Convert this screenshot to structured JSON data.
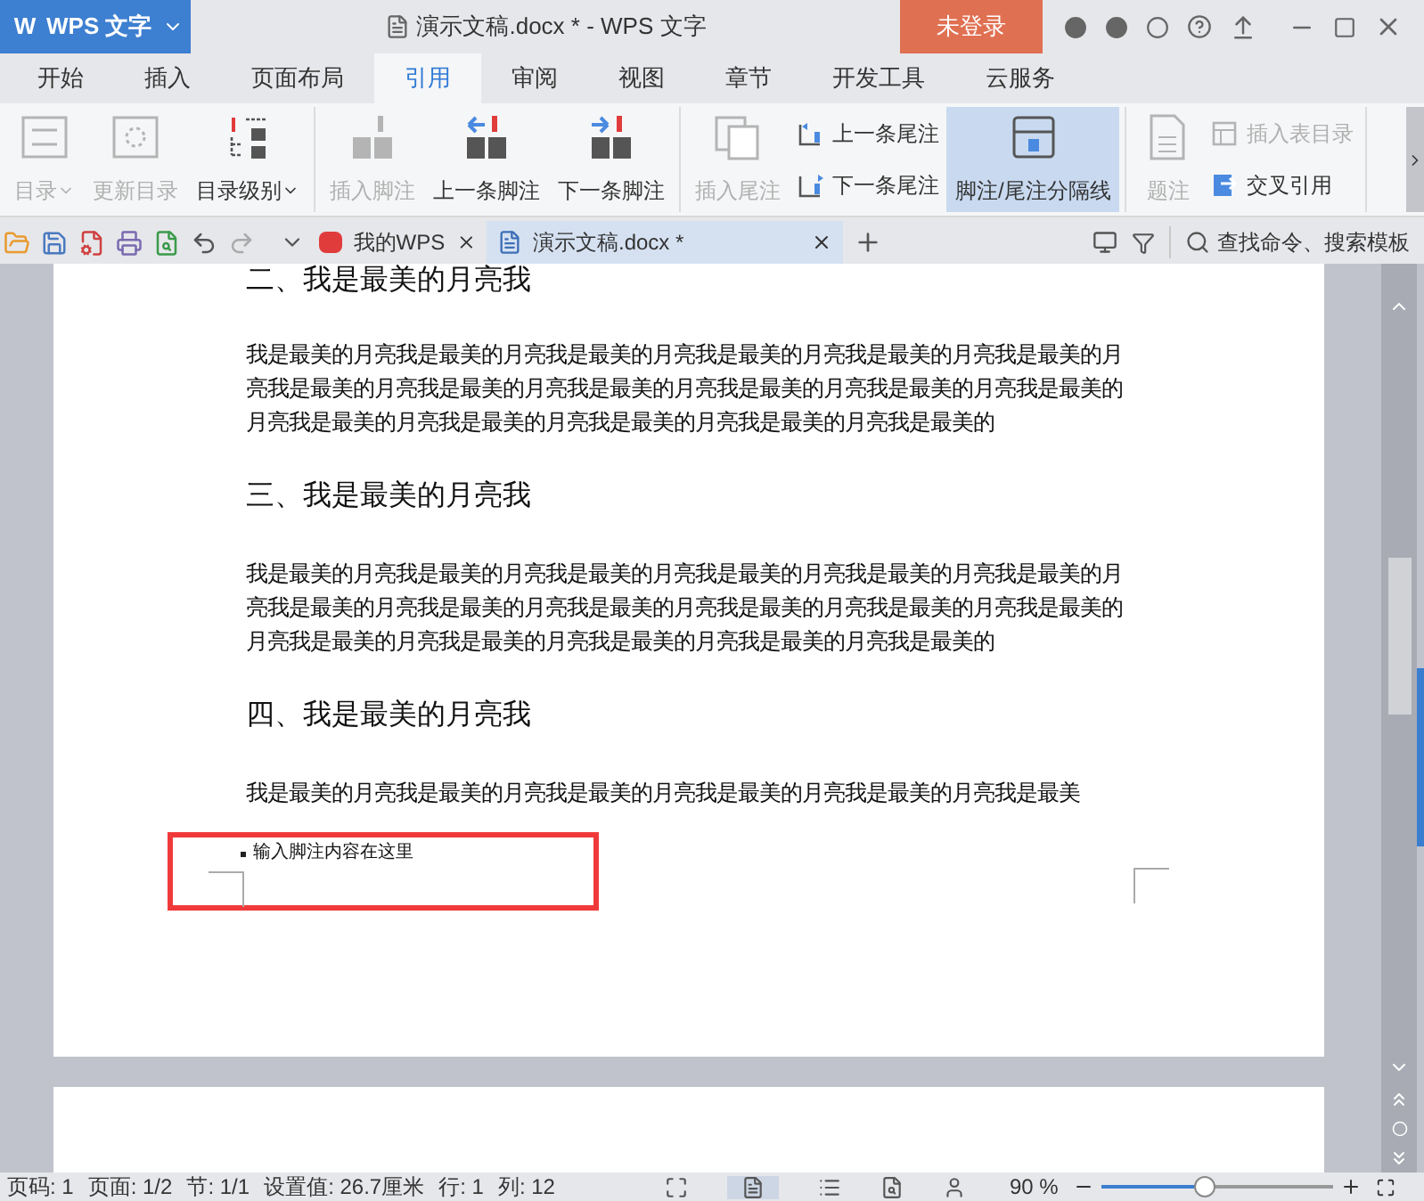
{
  "app": {
    "logo": "W",
    "name": "WPS 文字"
  },
  "window": {
    "title": "演示文稿.docx * - WPS 文字",
    "login_button": "未登录"
  },
  "tabs": [
    {
      "label": "开始",
      "selected": false
    },
    {
      "label": "插入",
      "selected": false
    },
    {
      "label": "页面布局",
      "selected": false
    },
    {
      "label": "引用",
      "selected": true
    },
    {
      "label": "审阅",
      "selected": false
    },
    {
      "label": "视图",
      "selected": false
    },
    {
      "label": "章节",
      "selected": false
    },
    {
      "label": "开发工具",
      "selected": false
    },
    {
      "label": "云服务",
      "selected": false
    }
  ],
  "ribbon": [
    {
      "items": [
        {
          "kind": "large",
          "label": "目录",
          "dropdown": true,
          "disabled": true,
          "selected": false
        },
        {
          "kind": "large",
          "label": "更新目录",
          "disabled": true,
          "selected": false
        },
        {
          "kind": "large",
          "label": "目录级别",
          "dropdown": true,
          "disabled": false,
          "selected": false
        }
      ]
    },
    {
      "items": [
        {
          "kind": "large",
          "label": "插入脚注",
          "disabled": true,
          "selected": false
        },
        {
          "kind": "large",
          "label": "上一条脚注",
          "disabled": false,
          "selected": false
        },
        {
          "kind": "large",
          "label": "下一条脚注",
          "disabled": false,
          "selected": false
        }
      ]
    },
    {
      "items": [
        {
          "kind": "large",
          "label": "插入尾注",
          "disabled": true,
          "selected": false
        },
        {
          "kind": "small",
          "label": "上一条尾注",
          "disabled": false,
          "selected": false
        },
        {
          "kind": "small",
          "label": "下一条尾注",
          "disabled": false,
          "selected": false
        },
        {
          "kind": "large",
          "label": "脚注/尾注分隔线",
          "disabled": false,
          "selected": true
        }
      ]
    },
    {
      "items": [
        {
          "kind": "large",
          "label": "题注",
          "disabled": true,
          "selected": false
        },
        {
          "kind": "small",
          "label": "插入表目录",
          "disabled": true,
          "selected": false
        },
        {
          "kind": "small",
          "label": "交叉引用",
          "disabled": false,
          "selected": false
        }
      ]
    }
  ],
  "doc_tabs": [
    {
      "label": "我的WPS",
      "kind": "home",
      "selected": false
    },
    {
      "label": "演示文稿.docx *",
      "kind": "doc",
      "selected": true
    }
  ],
  "search": {
    "placeholder": "查找命令、搜索模板"
  },
  "document": [
    {
      "kind": "heading",
      "text": "二、我是最美的月亮我"
    },
    {
      "kind": "paragraph",
      "text": "我是最美的月亮我是最美的月亮我是最美的月亮我是最美的月亮我是最美的月亮我是最美的月亮我是最美的月亮我是最美的月亮我是最美的月亮我是最美的月亮我是最美的月亮我是最美的月亮我是最美的月亮我是最美的月亮我是最美的月亮我是最美的月亮我是最美的"
    },
    {
      "kind": "heading",
      "text": "三、我是最美的月亮我"
    },
    {
      "kind": "paragraph",
      "text": "我是最美的月亮我是最美的月亮我是最美的月亮我是最美的月亮我是最美的月亮我是最美的月亮我是最美的月亮我是最美的月亮我是最美的月亮我是最美的月亮我是最美的月亮我是最美的月亮我是最美的月亮我是最美的月亮我是最美的月亮我是最美的月亮我是最美的"
    },
    {
      "kind": "heading",
      "text": "四、我是最美的月亮我"
    },
    {
      "kind": "paragraph",
      "text": "我是最美的月亮我是最美的月亮我是最美的月亮我是最美的月亮我是最美的月亮我是最美"
    }
  ],
  "footnote": {
    "text": "输入脚注内容在这里"
  },
  "status_bar": {
    "items": [
      "页码: 1",
      "页面: 1/2",
      "节: 1/1",
      "设置值: 26.7厘米",
      "行: 1",
      "列: 12"
    ],
    "zoom": "90 %",
    "zoom_slider": {
      "level": 0.45
    }
  }
}
